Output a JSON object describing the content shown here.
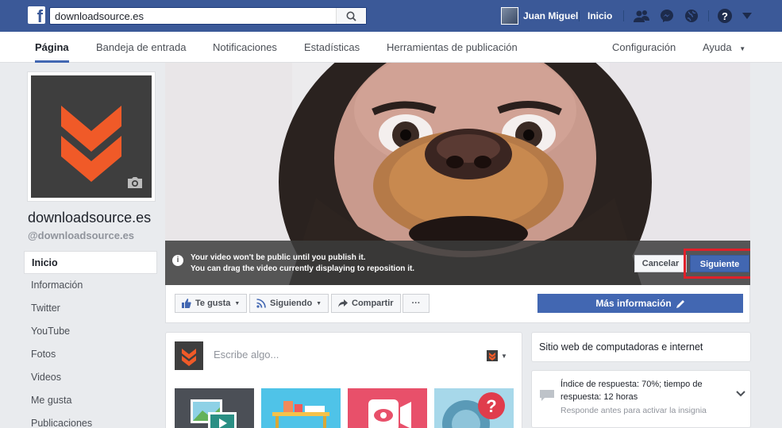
{
  "topbar": {
    "logo": "f",
    "search_value": "downloadsource.es",
    "user_name": "Juan Miguel",
    "home_label": "Inicio",
    "icons": [
      "friends-icon",
      "messenger-icon",
      "globe-icon",
      "help-icon",
      "caret-down-icon"
    ]
  },
  "pagenav": {
    "tabs": [
      {
        "label": "Página",
        "active": true
      },
      {
        "label": "Bandeja de entrada"
      },
      {
        "label": "Notificaciones"
      },
      {
        "label": "Estadísticas"
      },
      {
        "label": "Herramientas de publicación"
      }
    ],
    "settings_label": "Configuración",
    "help_label": "Ayuda"
  },
  "profile": {
    "name": "downloadsource.es",
    "handle": "@downloadsource.es",
    "nav": [
      "Inicio",
      "Información",
      "Twitter",
      "YouTube",
      "Fotos",
      "Videos",
      "Me gusta",
      "Publicaciones"
    ]
  },
  "cover": {
    "notice_line1": "Your video won't be public until you publish it.",
    "notice_line2": "You can drag the video currently displaying to reposition it.",
    "cancel_label": "Cancelar",
    "next_label": "Siguiente"
  },
  "actions": {
    "like_label": "Te gusta",
    "following_label": "Siguiendo",
    "share_label": "Compartir",
    "more_label": "···",
    "more_info_label": "Más información"
  },
  "composer": {
    "placeholder": "Escribe algo..."
  },
  "about": {
    "description": "Sitio web de computadoras e internet"
  },
  "response": {
    "line1": "Índice de respuesta: 70%; tiempo de respuesta: 12 horas",
    "line2": "Responde antes para activar la insignia"
  },
  "colors": {
    "fb_blue": "#3b5998",
    "button_blue": "#4267b2",
    "highlight_red": "#e0202a",
    "brand_orange": "#f05a28"
  }
}
